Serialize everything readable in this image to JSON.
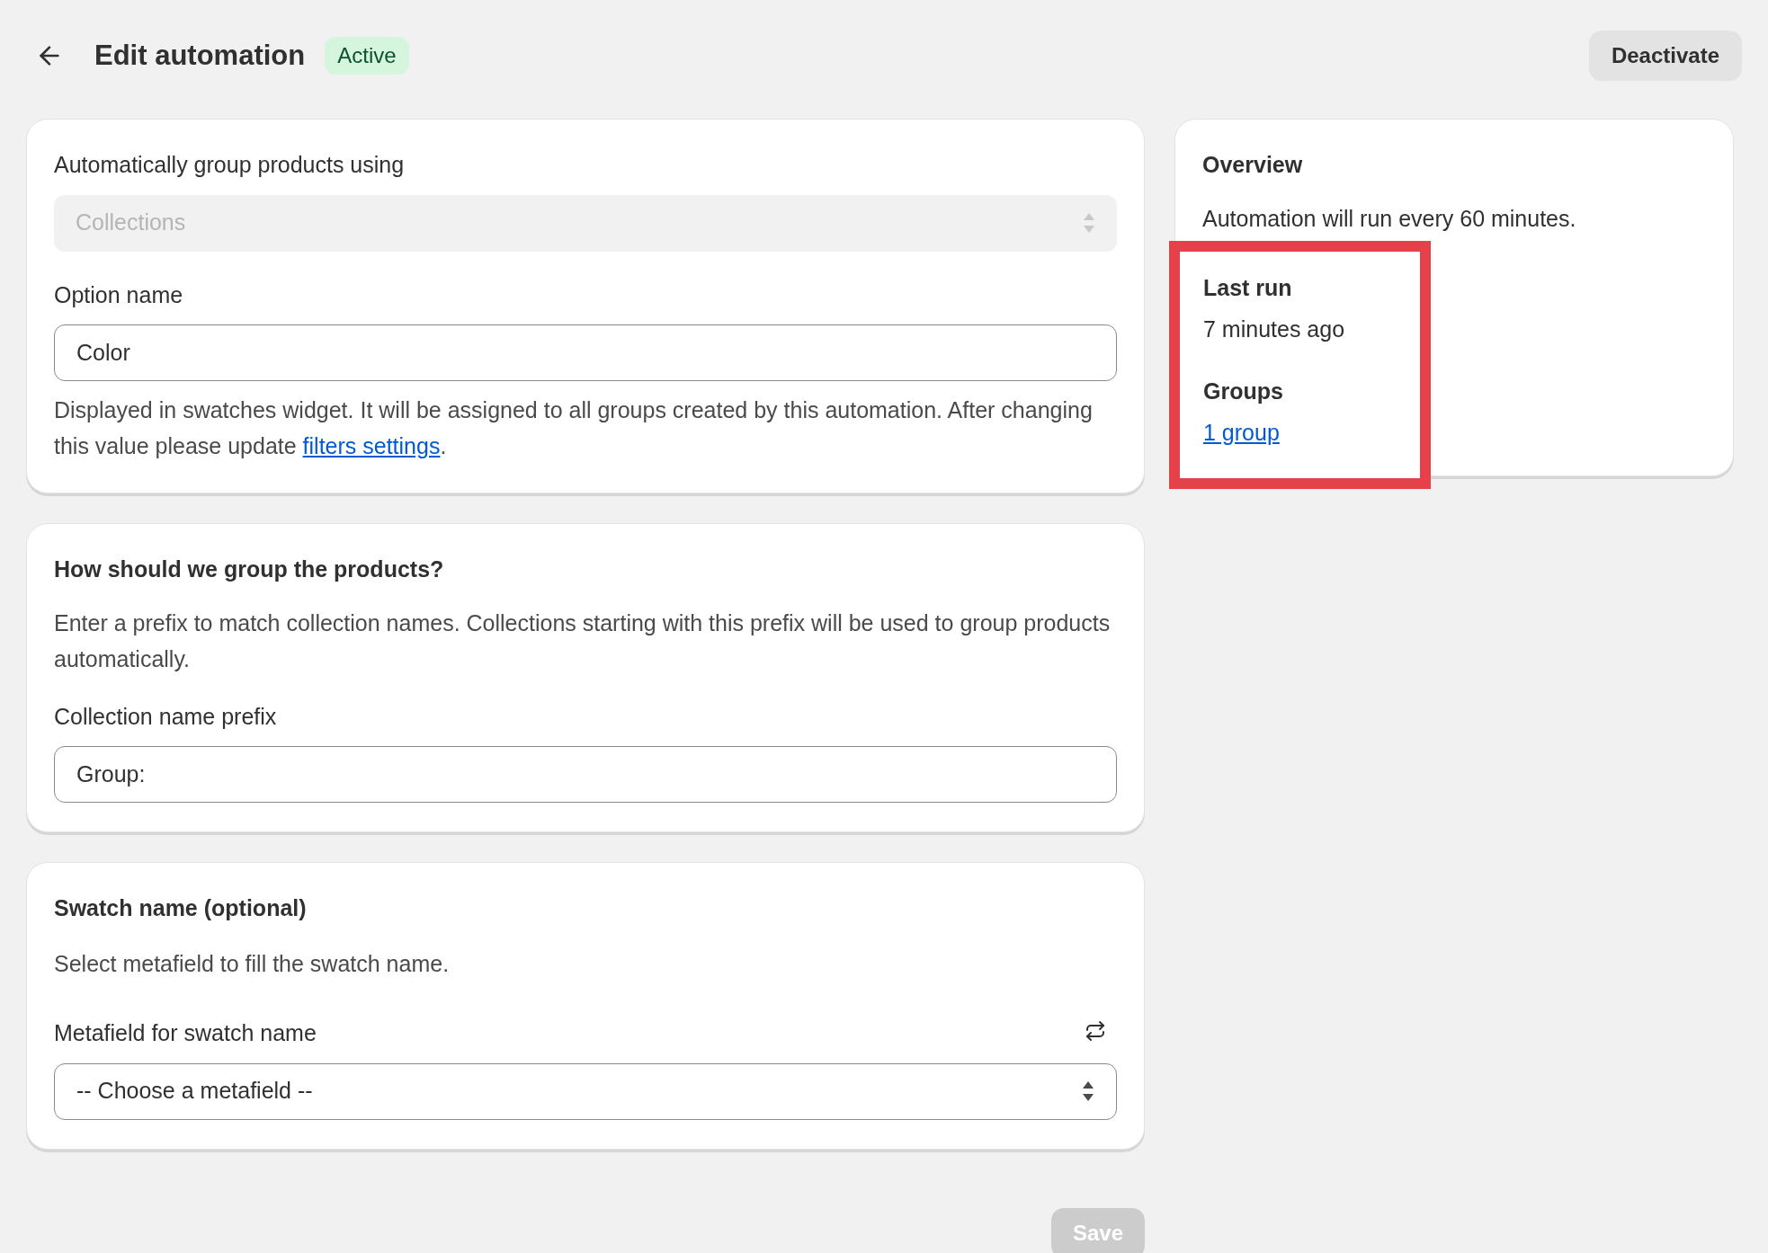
{
  "header": {
    "title": "Edit automation",
    "status_badge": "Active",
    "deactivate_button": "Deactivate"
  },
  "grouping_card": {
    "source_label": "Automatically group products using",
    "source_select": {
      "value": "Collections",
      "disabled": true
    },
    "option_label": "Option name",
    "option_value": "Color",
    "help_text": "Displayed in swatches widget. It will be assigned to all groups created by this automation. After changing this value please update ",
    "help_link": "filters settings",
    "help_end": "."
  },
  "group_card": {
    "title": "How should we group the products?",
    "description": "Enter a prefix to match collection names. Collections starting with this prefix will be used to group products automatically.",
    "prefix_label": "Collection name prefix",
    "prefix_value": "Group:"
  },
  "swatch_card": {
    "title": "Swatch name (optional)",
    "description": "Select metafield to fill the swatch name.",
    "metafield_label": "Metafield for swatch name",
    "metafield_select": {
      "value": "-- Choose a metafield --",
      "disabled": false
    }
  },
  "overview": {
    "title": "Overview",
    "schedule": "Automation will run every 60 minutes.",
    "highlighted": true,
    "last_run_label": "Last run",
    "last_run_value": "7 minutes ago",
    "groups_label": "Groups",
    "groups_link": "1 group"
  },
  "save_button": {
    "label": "Save",
    "disabled": true
  }
}
